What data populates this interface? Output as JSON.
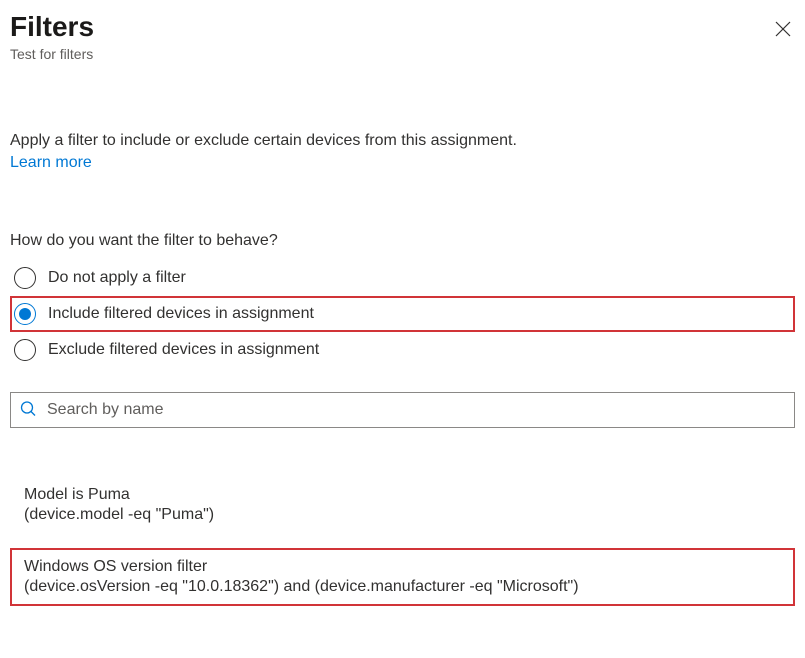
{
  "header": {
    "title": "Filters",
    "subtitle": "Test for filters"
  },
  "description": "Apply a filter to include or exclude certain devices from this assignment.",
  "learn_more": "Learn more",
  "question": "How do you want the filter to behave?",
  "options": {
    "none": "Do not apply a filter",
    "include": "Include filtered devices in assignment",
    "exclude": "Exclude filtered devices in assignment"
  },
  "search": {
    "placeholder": "Search by name",
    "value": ""
  },
  "filters": [
    {
      "name": "Model is Puma",
      "rule": "(device.model -eq \"Puma\")"
    },
    {
      "name": "Windows OS version filter",
      "rule": "(device.osVersion -eq \"10.0.18362\") and (device.manufacturer -eq \"Microsoft\")"
    }
  ]
}
